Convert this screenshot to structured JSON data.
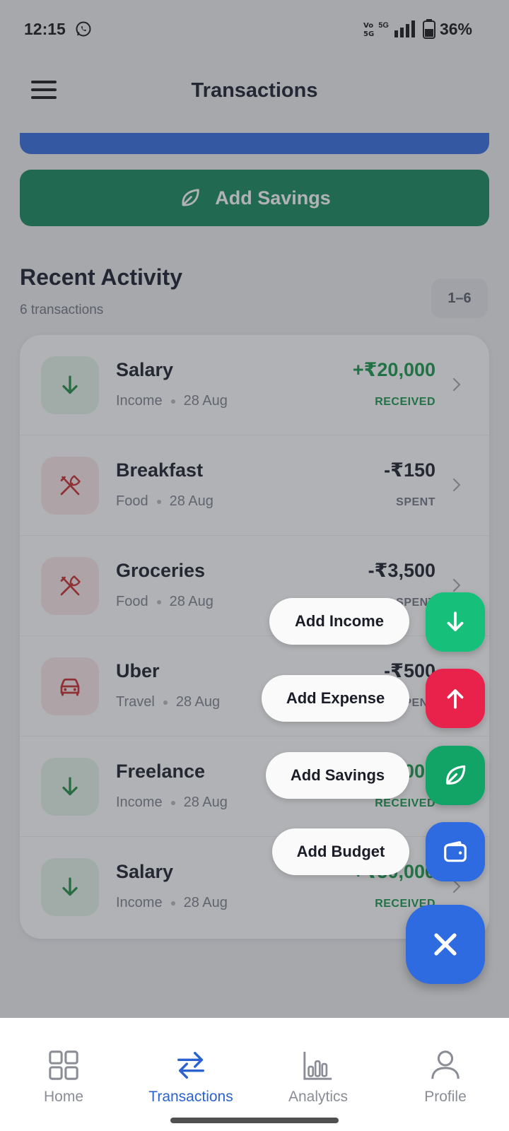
{
  "status_bar": {
    "time": "12:15",
    "network": "5G",
    "battery": "36%"
  },
  "header": {
    "title": "Transactions"
  },
  "actions": {
    "add_savings_label": "Add Savings"
  },
  "recent": {
    "title": "Recent Activity",
    "count_text": "6 transactions",
    "range": "1–6"
  },
  "transactions": [
    {
      "title": "Salary",
      "category": "Income",
      "date": "28 Aug",
      "amount": "+₹20,000",
      "status": "RECEIVED",
      "kind": "income"
    },
    {
      "title": "Breakfast",
      "category": "Food",
      "date": "28 Aug",
      "amount": "-₹150",
      "status": "SPENT",
      "kind": "expense"
    },
    {
      "title": "Groceries",
      "category": "Food",
      "date": "28 Aug",
      "amount": "-₹3,500",
      "status": "SPENT",
      "kind": "expense"
    },
    {
      "title": "Uber",
      "category": "Travel",
      "date": "28 Aug",
      "amount": "-₹500",
      "status": "SPENT",
      "kind": "expense"
    },
    {
      "title": "Freelance",
      "category": "Income",
      "date": "28 Aug",
      "amount": "+₹5,000",
      "status": "RECEIVED",
      "kind": "income"
    },
    {
      "title": "Salary",
      "category": "Income",
      "date": "28 Aug",
      "amount": "+₹50,000",
      "status": "RECEIVED",
      "kind": "income"
    }
  ],
  "fab_menu": {
    "add_income": "Add Income",
    "add_expense": "Add Expense",
    "add_savings": "Add Savings",
    "add_budget": "Add Budget"
  },
  "nav": {
    "home": "Home",
    "transactions": "Transactions",
    "analytics": "Analytics",
    "profile": "Profile"
  },
  "colors": {
    "primary": "#2F6BE0",
    "savings_green": "#108658",
    "income_green": "#119447",
    "expense_red": "#C62828",
    "fab_income": "#17C07A",
    "fab_expense": "#E8224A",
    "fab_savings": "#12A467"
  }
}
